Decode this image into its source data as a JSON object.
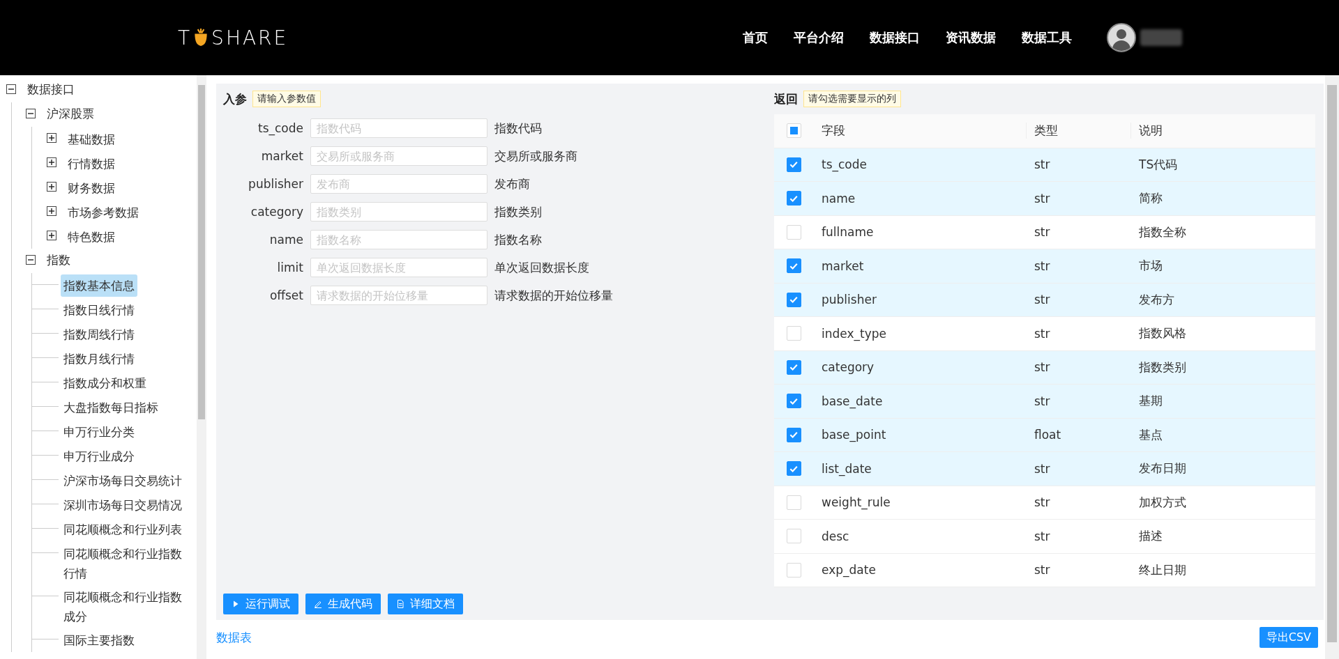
{
  "header": {
    "logo": {
      "before": "T",
      "after": "SHARE"
    },
    "nav": [
      "首页",
      "平台介绍",
      "数据接口",
      "资讯数据",
      "数据工具"
    ]
  },
  "sidebar": {
    "tree": [
      {
        "label": "数据接口",
        "expanded": true,
        "children": [
          {
            "label": "沪深股票",
            "expanded": true,
            "children": [
              {
                "label": "基础数据",
                "expanded": false
              },
              {
                "label": "行情数据",
                "expanded": false
              },
              {
                "label": "财务数据",
                "expanded": false
              },
              {
                "label": "市场参考数据",
                "expanded": false
              },
              {
                "label": "特色数据",
                "expanded": false
              }
            ]
          },
          {
            "label": "指数",
            "expanded": true,
            "children": [
              {
                "label": "指数基本信息",
                "selected": true
              },
              {
                "label": "指数日线行情",
                "selected": false
              },
              {
                "label": "指数周线行情",
                "selected": false
              },
              {
                "label": "指数月线行情",
                "selected": false
              },
              {
                "label": "指数成分和权重",
                "selected": false
              },
              {
                "label": "大盘指数每日指标",
                "selected": false
              },
              {
                "label": "申万行业分类",
                "selected": false
              },
              {
                "label": "申万行业成分",
                "selected": false
              },
              {
                "label": "沪深市场每日交易统计",
                "selected": false
              },
              {
                "label": "深圳市场每日交易情况",
                "selected": false
              },
              {
                "label": "同花顺概念和行业列表",
                "selected": false
              },
              {
                "label": "同花顺概念和行业指数行情",
                "selected": false
              },
              {
                "label": "同花顺概念和行业指数成分",
                "selected": false
              },
              {
                "label": "国际主要指数",
                "selected": false
              }
            ]
          }
        ]
      }
    ]
  },
  "params": {
    "title": "入参",
    "hint": "请输入参数值",
    "fields": [
      {
        "name": "ts_code",
        "placeholder": "指数代码",
        "description": "指数代码"
      },
      {
        "name": "market",
        "placeholder": "交易所或服务商",
        "description": "交易所或服务商"
      },
      {
        "name": "publisher",
        "placeholder": "发布商",
        "description": "发布商"
      },
      {
        "name": "category",
        "placeholder": "指数类别",
        "description": "指数类别"
      },
      {
        "name": "name",
        "placeholder": "指数名称",
        "description": "指数名称"
      },
      {
        "name": "limit",
        "placeholder": "单次返回数据长度",
        "description": "单次返回数据长度"
      },
      {
        "name": "offset",
        "placeholder": "请求数据的开始位移量",
        "description": "请求数据的开始位移量"
      }
    ],
    "buttons": [
      {
        "label": "运行调试",
        "kind": "run"
      },
      {
        "label": "生成代码",
        "kind": "edit"
      },
      {
        "label": "详细文档",
        "kind": "doc"
      }
    ]
  },
  "returns": {
    "title": "返回",
    "hint": "请勾选需要显示的列",
    "header_indeterminate": true,
    "columns": [
      "字段",
      "类型",
      "说明"
    ],
    "rows": [
      {
        "field": "ts_code",
        "type": "str",
        "description": "TS代码",
        "checked": true
      },
      {
        "field": "name",
        "type": "str",
        "description": "简称",
        "checked": true
      },
      {
        "field": "fullname",
        "type": "str",
        "description": "指数全称",
        "checked": false
      },
      {
        "field": "market",
        "type": "str",
        "description": "市场",
        "checked": true
      },
      {
        "field": "publisher",
        "type": "str",
        "description": "发布方",
        "checked": true
      },
      {
        "field": "index_type",
        "type": "str",
        "description": "指数风格",
        "checked": false
      },
      {
        "field": "category",
        "type": "str",
        "description": "指数类别",
        "checked": true
      },
      {
        "field": "base_date",
        "type": "str",
        "description": "基期",
        "checked": true
      },
      {
        "field": "base_point",
        "type": "float",
        "description": "基点",
        "checked": true
      },
      {
        "field": "list_date",
        "type": "str",
        "description": "发布日期",
        "checked": true
      },
      {
        "field": "weight_rule",
        "type": "str",
        "description": "加权方式",
        "checked": false
      },
      {
        "field": "desc",
        "type": "str",
        "description": "描述",
        "checked": false
      },
      {
        "field": "exp_date",
        "type": "str",
        "description": "终止日期",
        "checked": false
      }
    ]
  },
  "footer": {
    "link": "数据表",
    "export_button": "导出CSV"
  }
}
